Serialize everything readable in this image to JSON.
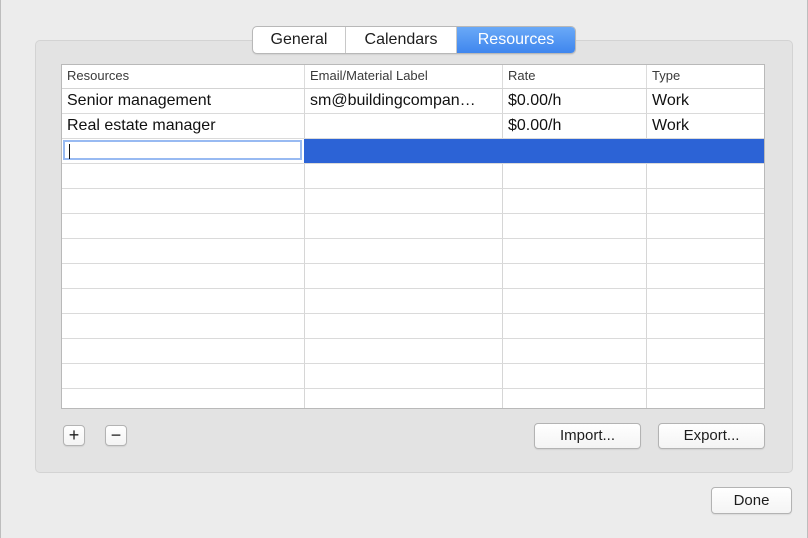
{
  "tabs": [
    {
      "label": "General"
    },
    {
      "label": "Calendars"
    },
    {
      "label": "Resources"
    }
  ],
  "table": {
    "columns": [
      "Resources",
      "Email/Material Label",
      "Rate",
      "Type"
    ],
    "rows": [
      [
        "Senior management",
        "sm@buildingcompan…",
        "$0.00/h",
        "Work"
      ],
      [
        "Real estate manager",
        "",
        "$0.00/h",
        "Work"
      ]
    ],
    "editing_row": {
      "name_value": ""
    }
  },
  "buttons": {
    "add_label": "+",
    "remove_label": "−",
    "import_label": "Import...",
    "export_label": "Export...",
    "done_label": "Done"
  },
  "colors": {
    "selection": "#2c63d6",
    "active_tab": "#4a8ff0"
  }
}
